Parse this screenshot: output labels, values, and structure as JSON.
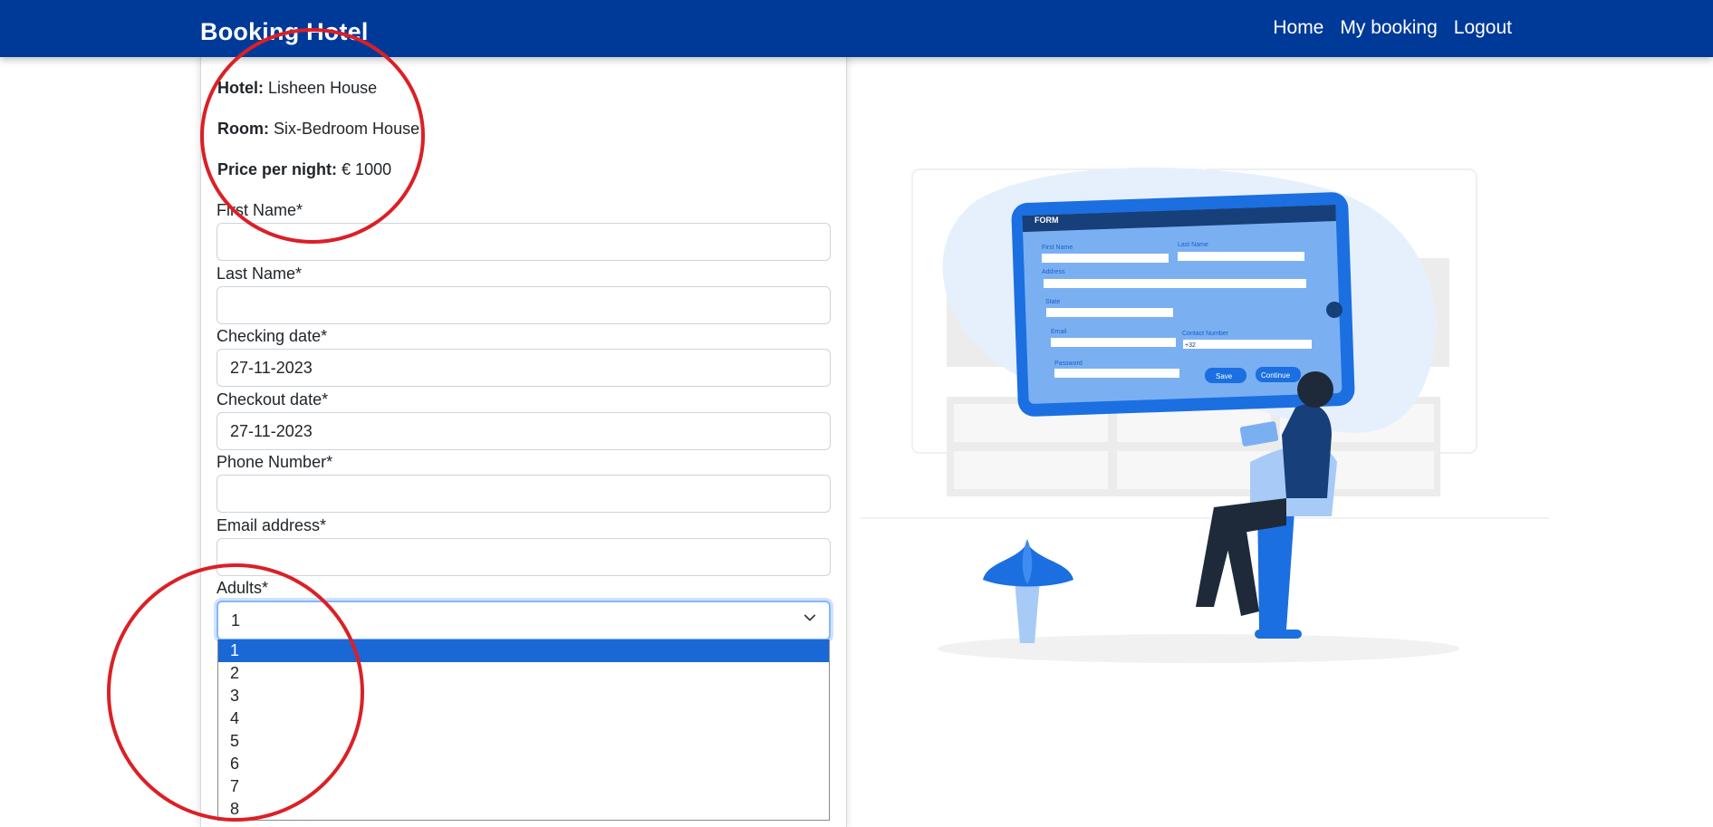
{
  "navbar": {
    "brand": "Booking Hotel",
    "links": [
      "Home",
      "My booking",
      "Logout"
    ]
  },
  "details": {
    "hotel_label": "Hotel:",
    "hotel_value": "Lisheen House",
    "room_label": "Room:",
    "room_value": "Six-Bedroom House",
    "price_label": "Price per night:",
    "price_value": "€ 1000"
  },
  "form": {
    "first_name_label": "First Name*",
    "first_name_value": "",
    "last_name_label": "Last Name*",
    "last_name_value": "",
    "checkin_label": "Checking date*",
    "checkin_value": "27-11-2023",
    "checkout_label": "Checkout date*",
    "checkout_value": "27-11-2023",
    "phone_label": "Phone Number*",
    "phone_value": "",
    "email_label": "Email address*",
    "email_value": "",
    "adults_label": "Adults*",
    "adults_value": "1",
    "adults_options": [
      "1",
      "2",
      "3",
      "4",
      "5",
      "6",
      "7",
      "8"
    ]
  },
  "illustration": {
    "form_title": "FORM",
    "first_name": "First Name",
    "last_name": "Last Name",
    "address": "Address",
    "state": "State",
    "email": "Email",
    "contact_number": "Contact Number",
    "country_code": "+32",
    "password": "Password",
    "save": "Save",
    "continue": "Continue"
  },
  "colors": {
    "navbar": "#003a99",
    "selected_option": "#1a68d6",
    "annotation": "#dc1f26"
  }
}
